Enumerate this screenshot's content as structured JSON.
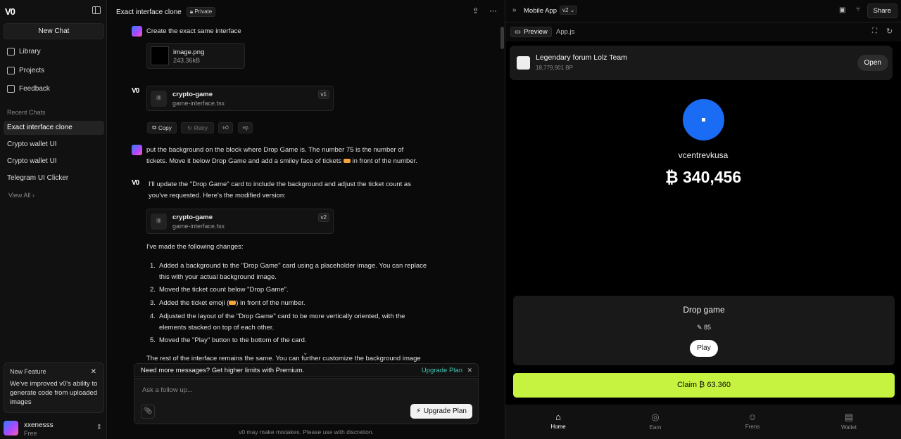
{
  "sidebar": {
    "logo": "V0",
    "new_chat": "New Chat",
    "nav": [
      {
        "label": "Library",
        "icon": "library-icon"
      },
      {
        "label": "Projects",
        "icon": "folder-icon"
      },
      {
        "label": "Feedback",
        "icon": "feedback-icon"
      }
    ],
    "recent_label": "Recent Chats",
    "recent": [
      "Exact interface clone",
      "Crypto wallet UI",
      "Crypto wallet UI",
      "Telegram UI Clicker"
    ],
    "view_all": "View All",
    "feature": {
      "title": "New Feature",
      "desc": "We've improved v0's ability to generate code from uploaded images"
    },
    "user": {
      "name": "xxenesss",
      "plan": "Free"
    }
  },
  "chat": {
    "title": "Exact interface clone",
    "privacy": "Private",
    "msg1": "Create the exact same interface",
    "file": {
      "name": "image.png",
      "size": "243.36kB"
    },
    "card1": {
      "name": "crypto-game",
      "file": "game-interface.tsx",
      "version": "v1"
    },
    "actions": {
      "copy": "Copy",
      "retry": "Retry"
    },
    "msg2_line1": "put the background on the block where Drop Game is. The number 75 is the number of",
    "msg2_line2a": "tickets. Move it below Drop Game and add a smiley face of tickets",
    "msg2_line2b": "in front of the number.",
    "reply_line1": "I'll update the \"Drop Game\" card to include the background and adjust the ticket count as",
    "reply_line2": "you've requested. Here's the modified version:",
    "card2": {
      "name": "crypto-game",
      "file": "game-interface.tsx",
      "version": "v2"
    },
    "changes_intro": "I've made the following changes:",
    "changes": [
      {
        "n": "1.",
        "l1": "Added a background to the \"Drop Game\" card using a placeholder image. You can replace",
        "l2": "this with your actual background image."
      },
      {
        "n": "2.",
        "l1": "Moved the ticket count below \"Drop Game\".",
        "l2": ""
      },
      {
        "n": "3.",
        "l1": "Added the ticket emoji (",
        "l1b": ") in front of the number.",
        "l2": ""
      },
      {
        "n": "4.",
        "l1": "Adjusted the layout of the \"Drop Game\" card to be more vertically oriented, with the",
        "l2": "elements stacked on top of each other."
      },
      {
        "n": "5.",
        "l1": "Moved the \"Play\" button to the bottom of the card.",
        "l2": ""
      }
    ],
    "tail": "The rest of the interface remains the same. You can further customize the background image",
    "notice": "Need more messages? Get higher limits with Premium.",
    "notice_cta": "Upgrade Plan",
    "composer_placeholder": "Ask a follow up...",
    "upgrade_button": "Upgrade Plan",
    "disclaimer": "v0 may make mistakes. Please use with discretion."
  },
  "preview": {
    "title": "Mobile App",
    "version": "v2",
    "share": "Share",
    "tabs": [
      "Preview",
      "App.js"
    ],
    "app": {
      "forum_name": "Legendary forum Lolz Team",
      "forum_bp": "18,779,901 BP",
      "open": "Open",
      "username": "vcentrevkusa",
      "balance": "₿ 340,456",
      "drop_title": "Drop game",
      "tickets": "85",
      "play": "Play",
      "claim": "Claim ₿ 63.360",
      "nav": [
        {
          "label": "Home",
          "icon": "home-icon"
        },
        {
          "label": "Earn",
          "icon": "coins-icon"
        },
        {
          "label": "Frens",
          "icon": "friends-icon"
        },
        {
          "label": "Wallet",
          "icon": "wallet-icon"
        }
      ]
    },
    "colors": {
      "accent": "#c6f33f",
      "avatar": "#1a6cf5",
      "link": "#3ec6b0"
    }
  }
}
